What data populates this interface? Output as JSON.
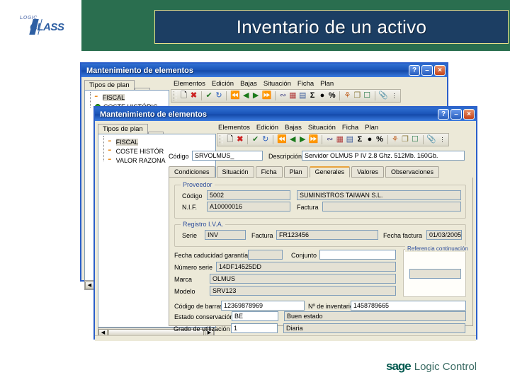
{
  "slide": {
    "logo_top": "LOGIC",
    "logo_main": "CLASS",
    "title": "Inventario de un  activo",
    "footer_brand": "sage",
    "footer_product": "Logic Control",
    "colors": {
      "band_green": "#2a6e4f",
      "title_navy": "#1c3e63",
      "title_border": "#e8e08a",
      "sage_green": "#00594f"
    }
  },
  "back_window": {
    "title": "Mantenimiento de elementos",
    "titlebar_buttons": {
      "help": "?",
      "minimize": "–",
      "close": "×"
    },
    "side_tab": "Tipos de plan",
    "tree": [
      {
        "label": "FISCAL",
        "icon": "bolt-icon",
        "selected": true
      },
      {
        "label": "COSTE HISTÓRIC",
        "icon": "green-dot-icon",
        "selected": false
      }
    ],
    "menu": [
      "Elementos",
      "Edición",
      "Bajas",
      "Situación",
      "Ficha",
      "Plan"
    ],
    "toolbar_icons": [
      "new-document-icon",
      "delete-red-x-icon",
      "confirm-check-icon",
      "refresh-icon",
      "first-record-icon",
      "previous-record-icon",
      "next-record-icon",
      "last-record-icon",
      "link-icon",
      "grid-table-icon",
      "report-icon",
      "sum-sigma-icon",
      "bullet-icon",
      "percent-icon",
      "filter-icon",
      "copy-icon",
      "export-icon",
      "attachment-clip-icon",
      "more-options-icon"
    ]
  },
  "front_window": {
    "title": "Mantenimiento de elementos",
    "titlebar_buttons": {
      "help": "?",
      "minimize": "–",
      "close": "×"
    },
    "side_tab": "Tipos de plan",
    "tree": [
      {
        "label": "FISCAL",
        "icon": "bolt-icon",
        "selected": true
      },
      {
        "label": "COSTE HISTÓR",
        "icon": "bolt-icon",
        "selected": false
      },
      {
        "label": "VALOR RAZONA",
        "icon": "bolt-icon",
        "selected": false
      }
    ],
    "menu": [
      "Elementos",
      "Edición",
      "Bajas",
      "Situación",
      "Ficha",
      "Plan"
    ],
    "toolbar_icons": [
      "new-document-icon",
      "delete-red-x-icon",
      "confirm-check-icon",
      "refresh-icon",
      "first-record-icon",
      "previous-record-icon",
      "next-record-icon",
      "last-record-icon",
      "link-icon",
      "grid-table-icon",
      "report-icon",
      "sum-sigma-icon",
      "bullet-icon",
      "percent-icon",
      "filter-icon",
      "copy-icon",
      "export-icon",
      "attachment-clip-icon",
      "more-options-icon"
    ],
    "header_fields": {
      "codigo_label": "Código",
      "codigo_value": "SRVOLMUS_",
      "descripcion_label": "Descripción",
      "descripcion_value": "Servidor OLMUS P IV 2.8 Ghz. 512Mb. 160Gb."
    },
    "tabs": [
      {
        "label": "Condiciones",
        "active": false
      },
      {
        "label": "Situación",
        "active": false
      },
      {
        "label": "Ficha",
        "active": false
      },
      {
        "label": "Plan",
        "active": false
      },
      {
        "label": "Generales",
        "active": true
      },
      {
        "label": "Valores",
        "active": false
      },
      {
        "label": "Observaciones",
        "active": false
      }
    ],
    "proveedor": {
      "group_title": "Proveedor",
      "codigo_label": "Código",
      "codigo_value": "5002",
      "nombre_value": "SUMINISTROS TAIWAN S.L.",
      "nif_label": "N.I.F.",
      "nif_value": "A10000016",
      "factura_label": "Factura",
      "factura_value": ""
    },
    "registro_iva": {
      "group_title": "Registro I.V.A.",
      "serie_label": "Serie",
      "serie_value": "INV",
      "factura_label": "Factura",
      "factura_value": "FR123456",
      "fecha_factura_label": "Fecha factura",
      "fecha_factura_value": "01/03/2005"
    },
    "detalle": {
      "fecha_garantia_label": "Fecha caducidad garantía",
      "fecha_garantia_value": "",
      "conjunto_label": "Conjunto",
      "conjunto_value": "",
      "numero_serie_label": "Número serie",
      "numero_serie_value": "14DF14525DD",
      "marca_label": "Marca",
      "marca_value": "OLMUS",
      "modelo_label": "Modelo",
      "modelo_value": "SRV123",
      "referencia_group_title": "Referencia continuación",
      "referencia_value": ""
    },
    "inventario": {
      "codigo_barras_label": "Código de barras",
      "codigo_barras_value": "12369878969",
      "num_inventario_label": "Nº de inventario",
      "num_inventario_value": "1458789665",
      "estado_label": "Estado conservación",
      "estado_code": "BE",
      "estado_text": "Buen estado",
      "grado_label": "Grado de utilización",
      "grado_code": "1",
      "grado_text": "Diaria"
    },
    "scrollbar": {
      "left_arrow": "◀",
      "right_arrow": "▶"
    }
  }
}
